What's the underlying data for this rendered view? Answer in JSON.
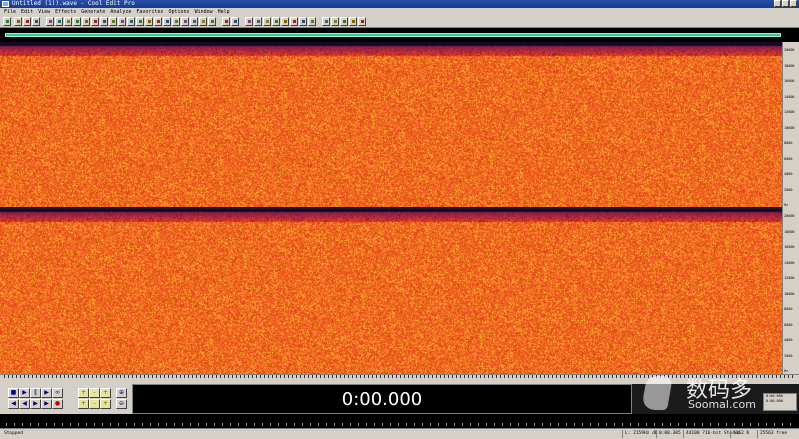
{
  "window": {
    "title": "Untitled (1)).wave - Cool Edit Pro"
  },
  "menu": [
    "File",
    "Edit",
    "View",
    "Effects",
    "Generate",
    "Analyze",
    "Favorites",
    "Options",
    "Window",
    "Help"
  ],
  "spectral": {
    "channels": 2,
    "colors": {
      "background": "#e8521a",
      "bright": "#ff9a2a",
      "dark": "#5a1030",
      "band": "#c22a3a"
    }
  },
  "frequency_ruler": [
    "20000",
    "18000",
    "16000",
    "14000",
    "12000",
    "10000",
    "8000",
    "6000",
    "4000",
    "2000",
    "Hz"
  ],
  "time_display": {
    "value": "0:00.000"
  },
  "selection": {
    "start": "0:00.000",
    "end": "0:00.000"
  },
  "status": {
    "state": "Stopped",
    "level": "L: 2159Hz dB",
    "position": "0:00.305",
    "format": "44100 ?16-bit Stereo",
    "size": "1152 K",
    "free": "25563 free"
  },
  "watermark": {
    "cn": "数码多",
    "en": "Soomal.com"
  },
  "colors": {
    "accent": "#37c89a",
    "chrome": "#d4d0c8",
    "title": "#163a8f"
  }
}
